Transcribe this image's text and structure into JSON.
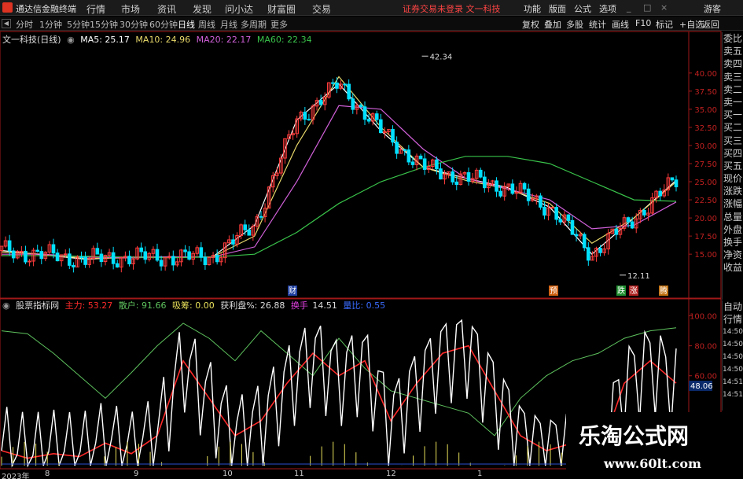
{
  "app": {
    "name": "通达信金融终端",
    "notice": "证券交易未登录   文一科技",
    "user": "游客"
  },
  "menu": [
    "行情",
    "市场",
    "资讯",
    "发现",
    "问小达",
    "财富圈",
    "交易"
  ],
  "right_menu": [
    "功能",
    "版面",
    "公式",
    "选项"
  ],
  "periods": [
    "分时",
    "1分钟",
    "5分钟",
    "15分钟",
    "30分钟",
    "60分钟",
    "日线",
    "周线",
    "月线",
    "多周期",
    "更多"
  ],
  "active_period": "日线",
  "toolbar_right": [
    "复权",
    "叠加",
    "多股",
    "统计",
    "画线",
    "F10",
    "标记",
    "+自选",
    "返回"
  ],
  "stock": {
    "title": "文一科技(日线)"
  },
  "ma": {
    "ma5": "MA5: 25.17",
    "ma10": "MA10: 24.96",
    "ma20": "MA20: 22.17",
    "ma60": "MA60: 22.34"
  },
  "indicator": {
    "name": "股票指标网",
    "main": "主力: 53.27",
    "retail": "散户: 91.66",
    "chip": "吸筹: 0.00",
    "profit": "获利盘%: 26.88",
    "turnover_label": "换手",
    "turnover": "14.51",
    "volume_ratio": "量比: 0.55"
  },
  "quote_side": [
    "委比",
    "卖五",
    "卖四",
    "卖三",
    "卖二",
    "卖一",
    "买一",
    "买二",
    "买三",
    "买四",
    "买五",
    "现价",
    "涨跌",
    "涨幅",
    "总量",
    "外盘",
    "换手",
    "净资",
    "收益"
  ],
  "side_bottom": [
    "自动",
    "行情",
    "14:50",
    "14:50",
    "14:50",
    "14:50",
    "14:51",
    "14:51"
  ],
  "markers": {
    "high": "42.34",
    "low": "12.11",
    "cai": "财",
    "yu": "预",
    "die": "跌",
    "zhang": "涨",
    "teng": "腾"
  },
  "current_value": "48.06",
  "dates": [
    "2023年",
    "8",
    "9",
    "10",
    "11",
    "12",
    "1"
  ],
  "watermark": {
    "title": "乐淘公式网",
    "url": "www.60lt.com"
  },
  "colors": {
    "up": "#ff3c3c",
    "down": "#00e0ff",
    "ma5": "#ffffff",
    "ma10": "#e8d86a",
    "ma20": "#d060d8",
    "ma60": "#39c24a",
    "main": "#ff2a2a",
    "retail": "#5ec25e",
    "white_line": "#ffffff",
    "yellow": "#e8e05a"
  },
  "chart_data": [
    {
      "type": "line",
      "title": "",
      "y_ticks": [
        15.0,
        17.5,
        20.0,
        22.5,
        25.0,
        27.5,
        30.0,
        32.5,
        35.0,
        37.5,
        40.0
      ],
      "ylim": [
        11,
        44
      ],
      "x": [
        "2023-07-25",
        "2023-08-01",
        "2023-09-01",
        "2023-10-01",
        "2023-11-01",
        "2023-12-01",
        "2024-01-01",
        "2024-02-01"
      ],
      "series": [
        {
          "name": "MA5",
          "values": [
            15.5,
            14.9,
            14.3,
            14.6,
            14.6,
            14.6,
            19.0,
            33.5,
            38.5,
            32.0,
            27.0,
            25.5,
            24.2,
            21.5,
            15.0,
            20.0,
            25.2
          ]
        },
        {
          "name": "MA10",
          "values": [
            15.3,
            15.0,
            14.4,
            14.5,
            14.6,
            14.6,
            17.5,
            30.0,
            39.5,
            32.5,
            27.0,
            25.2,
            24.0,
            22.0,
            16.5,
            20.0,
            25.0
          ]
        },
        {
          "name": "MA20",
          "values": [
            15.0,
            15.0,
            14.6,
            14.5,
            14.6,
            14.6,
            16.0,
            25.0,
            35.5,
            35.0,
            29.5,
            25.5,
            24.0,
            22.5,
            18.5,
            19.0,
            22.2
          ]
        },
        {
          "name": "MA60",
          "values": [
            14.8,
            14.8,
            14.7,
            14.6,
            14.5,
            14.6,
            15.0,
            18.0,
            22.0,
            25.0,
            27.0,
            28.5,
            28.5,
            27.5,
            25.0,
            22.5,
            22.3
          ]
        }
      ],
      "annotations": [
        {
          "label": "42.34",
          "x": "2023-11-21",
          "y": 42.34
        },
        {
          "label": "12.11",
          "x": "2024-01-16",
          "y": 12.11
        }
      ]
    },
    {
      "type": "line",
      "title": "股票指标网",
      "y_ticks": [
        60.0,
        80.0,
        100.0
      ],
      "ylim": [
        0,
        105
      ],
      "series": [
        {
          "name": "主力",
          "values": [
            10,
            5,
            8,
            6,
            15,
            8,
            20,
            70,
            45,
            20,
            30,
            55,
            75,
            60,
            70,
            30,
            55,
            75,
            80,
            50,
            20,
            10,
            15,
            5,
            55,
            70,
            55
          ]
        },
        {
          "name": "散户",
          "values": [
            90,
            88,
            75,
            60,
            45,
            62,
            80,
            95,
            85,
            70,
            90,
            75,
            60,
            85,
            65,
            50,
            45,
            40,
            35,
            20,
            45,
            60,
            70,
            75,
            85,
            90,
            92
          ]
        }
      ]
    }
  ]
}
